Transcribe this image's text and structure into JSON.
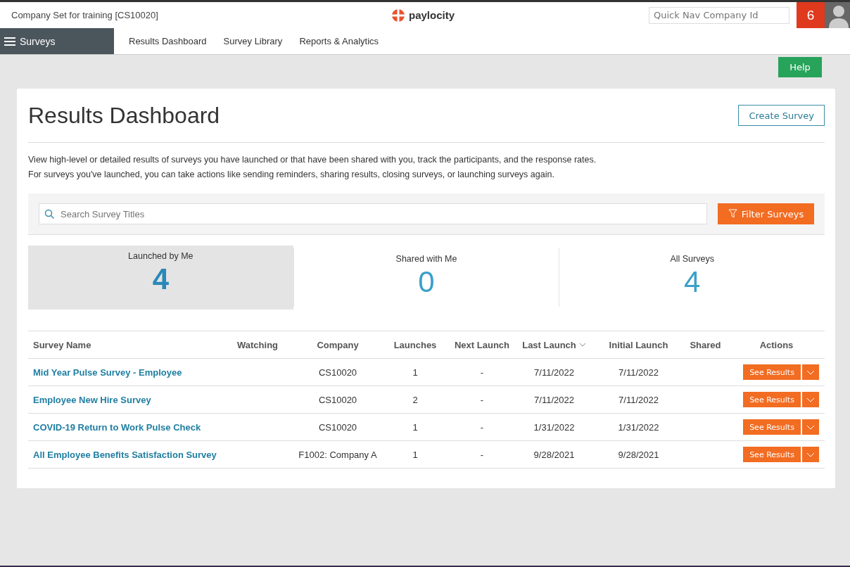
{
  "top_bar": {
    "company": "Company Set for training [CS10020]",
    "logo_text": "paylocity",
    "quick_nav": {
      "placeholder": "Quick Nav Company Id"
    },
    "notification_count": "6"
  },
  "nav": {
    "menu_label": "Surveys",
    "links": [
      {
        "label": "Results Dashboard"
      },
      {
        "label": "Survey Library"
      },
      {
        "label": "Reports & Analytics"
      }
    ]
  },
  "help_button": "Help",
  "page": {
    "title": "Results Dashboard",
    "create_button": "Create Survey",
    "description": [
      "View high-level or detailed results of surveys you have launched or that have been shared with you, track the participants, and the response rates.",
      "For surveys you've launched, you can take actions like sending reminders, sharing results, closing surveys, or launching surveys again."
    ],
    "search": {
      "placeholder": "Search Survey Titles"
    },
    "filter_button": "Filter Surveys",
    "stats": [
      {
        "label": "Launched by Me",
        "count": "4",
        "selected": true
      },
      {
        "label": "Shared with Me",
        "count": "0",
        "selected": false
      },
      {
        "label": "All Surveys",
        "count": "4",
        "selected": false
      }
    ],
    "table": {
      "columns": [
        {
          "label": "Survey Name",
          "sorted": false
        },
        {
          "label": "Watching",
          "sorted": false
        },
        {
          "label": "Company",
          "sorted": false
        },
        {
          "label": "Launches",
          "sorted": false
        },
        {
          "label": "Next Launch",
          "sorted": false
        },
        {
          "label": "Last Launch",
          "sorted": true
        },
        {
          "label": "Initial Launch",
          "sorted": false
        },
        {
          "label": "Shared",
          "sorted": false
        },
        {
          "label": "Actions",
          "sorted": false
        }
      ],
      "rows": [
        {
          "name": "Mid Year Pulse Survey - Employee",
          "company": "CS10020",
          "launches": "1",
          "next_launch": "-",
          "last_launch": "7/11/2022",
          "initial_launch": "7/11/2022",
          "action": "See Results"
        },
        {
          "name": "Employee New Hire Survey",
          "company": "CS10020",
          "launches": "2",
          "next_launch": "-",
          "last_launch": "7/11/2022",
          "initial_launch": "7/11/2022",
          "action": "See Results"
        },
        {
          "name": "COVID-19 Return to Work Pulse Check",
          "company": "CS10020",
          "launches": "1",
          "next_launch": "-",
          "last_launch": "1/31/2022",
          "initial_launch": "1/31/2022",
          "action": "See Results"
        },
        {
          "name": "All Employee Benefits Satisfaction Survey",
          "company": "F1002: Company A",
          "launches": "1",
          "next_launch": "-",
          "last_launch": "9/28/2021",
          "initial_launch": "9/28/2021",
          "action": "See Results"
        }
      ]
    }
  }
}
